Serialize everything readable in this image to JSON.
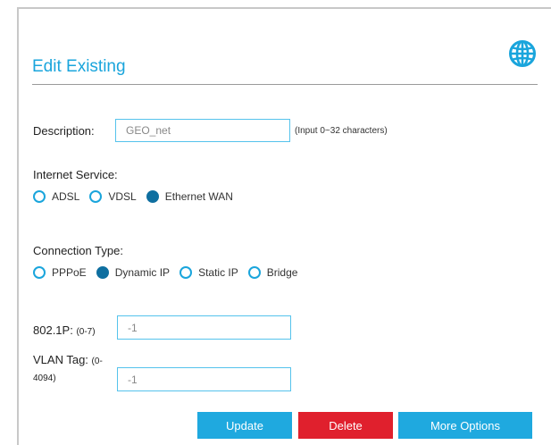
{
  "header": {
    "title": "Edit Existing",
    "icon": "globe-icon"
  },
  "description": {
    "label": "Description:",
    "value": "GEO_net",
    "hint": "(Input 0~32 characters)"
  },
  "internet_service": {
    "label": "Internet Service:",
    "options": [
      "ADSL",
      "VDSL",
      "Ethernet WAN"
    ],
    "selected": "Ethernet WAN"
  },
  "connection_type": {
    "label": "Connection Type:",
    "options": [
      "PPPoE",
      "Dynamic IP",
      "Static IP",
      "Bridge"
    ],
    "selected": "Dynamic IP"
  },
  "priority": {
    "label": "802.1P:",
    "range": "(0-7)",
    "value": "-1"
  },
  "vlan": {
    "label": "VLAN Tag:",
    "range_part1": "(0-",
    "range_part2": "4094)",
    "value": "-1"
  },
  "buttons": {
    "update": "Update",
    "delete": "Delete",
    "more_options": "More Options"
  },
  "colors": {
    "accent": "#1fa9df",
    "danger": "#e0202d",
    "radio_selected": "#0f6fa0"
  }
}
